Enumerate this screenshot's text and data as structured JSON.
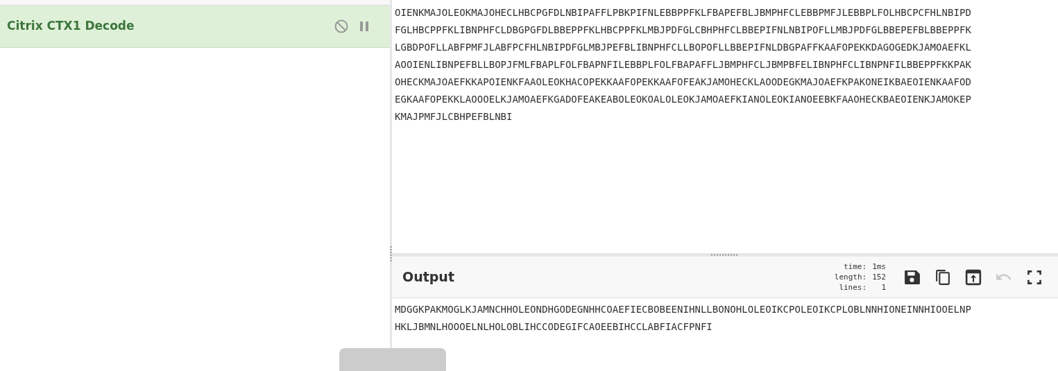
{
  "recipe": {
    "operations": [
      {
        "name": "Citrix CTX1 Decode"
      }
    ]
  },
  "input": {
    "lines": [
      "OIENKMAJOLEOKMAJOHECLHBCPGFDLNBIPAFFLPBKPIFNLEBBPPFKLFBAPEFBLJBMPHFCLEBBPMFJLEBBPLFOLHBCPCFHLNBIPD",
      "FGLHBCPPFKLIBNPHFCLDBGPGFDLBBEPPFKLHBCPPFKLMBJPDFGLCBHPHFCLBBEPIFNLNBIPOFLLMBJPDFGLBBEPEFBLBBEPPFK",
      "LGBDPOFLLABFPMFJLABFPCFHLNBIPDFGLMBJPEFBLIBNPHFCLLBOPOFLLBBEPIFNLDBGPAFFKAAFOPEKKDAGOGEDKJAMOAEFKL",
      "AOOIENLIBNPEFBLLBOPJFMLFBAPLFOLFBAPNFILEBBPLFOLFBAPAFFLJBMPHFCLJBMPBFELIBNPHFCLIBNPNFILBBEPPFKKPAK",
      "OHECKMAJOAEFKKAPOIENKFAAOLEOKHACOPEKKAAFOPEKKAAFOFEAKJAMOHECKLAOODEGKMAJOAEFKPAKONEIKBAEOIENKAAFOD",
      "EGKAAFOPEKKLAOOOELKJAMOAEFKGADOFEAKEABOLEOKOALOLEOKJAMOAEFKIANOLEOKIANOEEBKFAAOHECKBAEOIENKJAMOKEP",
      "KMAJPMFJLCBHPEFBLNBI"
    ]
  },
  "output": {
    "title": "Output",
    "stats": [
      {
        "label": "time:",
        "value": "1ms"
      },
      {
        "label": "length:",
        "value": "152"
      },
      {
        "label": "lines:",
        "value": "1"
      }
    ],
    "buttons": [
      {
        "kind": "save",
        "disabled": false
      },
      {
        "kind": "copy",
        "disabled": false
      },
      {
        "kind": "replace",
        "disabled": false
      },
      {
        "kind": "undo",
        "disabled": true
      },
      {
        "kind": "maximise",
        "disabled": false
      }
    ],
    "lines": [
      "MDGGKPAKMOGLKJAMNCHHOLEONDHGODEGNHHCOAEFIECBOBEENIHNLLBONOHLOLEOIKCPOLEOIKCPLOBLNNHIONEINNHIOOELNP",
      "HKLJBMNLHOOOELNLHOLOBLIHCCODEGIFCAOEEBIHCCLABFIACFPNFI"
    ]
  }
}
